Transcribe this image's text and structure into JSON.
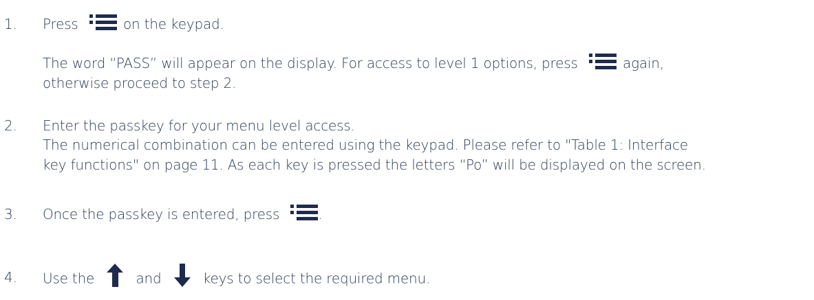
{
  "steps": [
    {
      "number": "1.",
      "text_before_icon": "Press",
      "icon": "menu-icon",
      "text_after_icon": "on the keypad.",
      "note_line1_before_icon": "The word “PASS” will appear on the display. For access to level 1 options, press",
      "note_icon": "menu-icon",
      "note_line1_after_icon": "again,",
      "note_line2": "otherwise proceed to step 2."
    },
    {
      "number": "2.",
      "line1": "Enter the passkey for your menu level access.",
      "line2": "The numerical combination can be entered using the keypad. Please refer to \"Table 1: Interface",
      "line3": "key functions\" on page 11. As each key is pressed the letters “Po” will be displayed on the screen."
    },
    {
      "number": "3.",
      "text_before_icon": "Once the passkey is entered, press",
      "icon": "menu-icon",
      "text_after_icon": "."
    },
    {
      "number": "4.",
      "text_before_up": "Use the",
      "up_icon": "arrow-up-icon",
      "text_between": "and",
      "down_icon": "arrow-down-icon",
      "text_after_down": "keys to select the required menu."
    }
  ],
  "colors": {
    "text": "#2b3a55",
    "icon": "#1e2b4d"
  }
}
